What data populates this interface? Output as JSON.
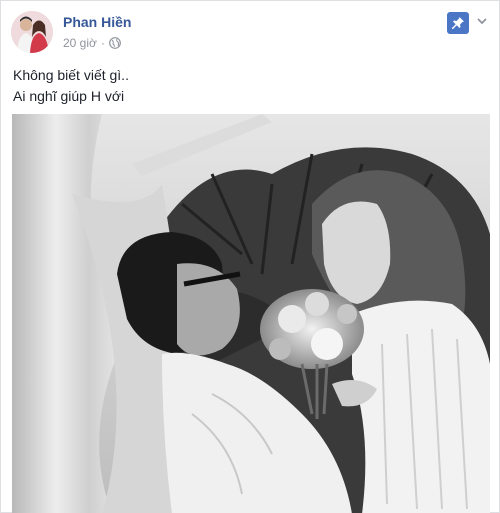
{
  "post": {
    "author_name": "Phan Hiền",
    "timestamp": "20 giờ",
    "separator": "·",
    "privacy_icon": "globe-icon",
    "pin_icon": "pin-icon",
    "menu_icon": "chevron-down-icon",
    "text_lines": [
      "Không biết viết gì..",
      "Ai nghĩ giúp H với"
    ]
  },
  "colors": {
    "author_link": "#365899",
    "meta_text": "#90949c",
    "pin_bg": "#4a76c5",
    "body_text": "#1d2129"
  }
}
